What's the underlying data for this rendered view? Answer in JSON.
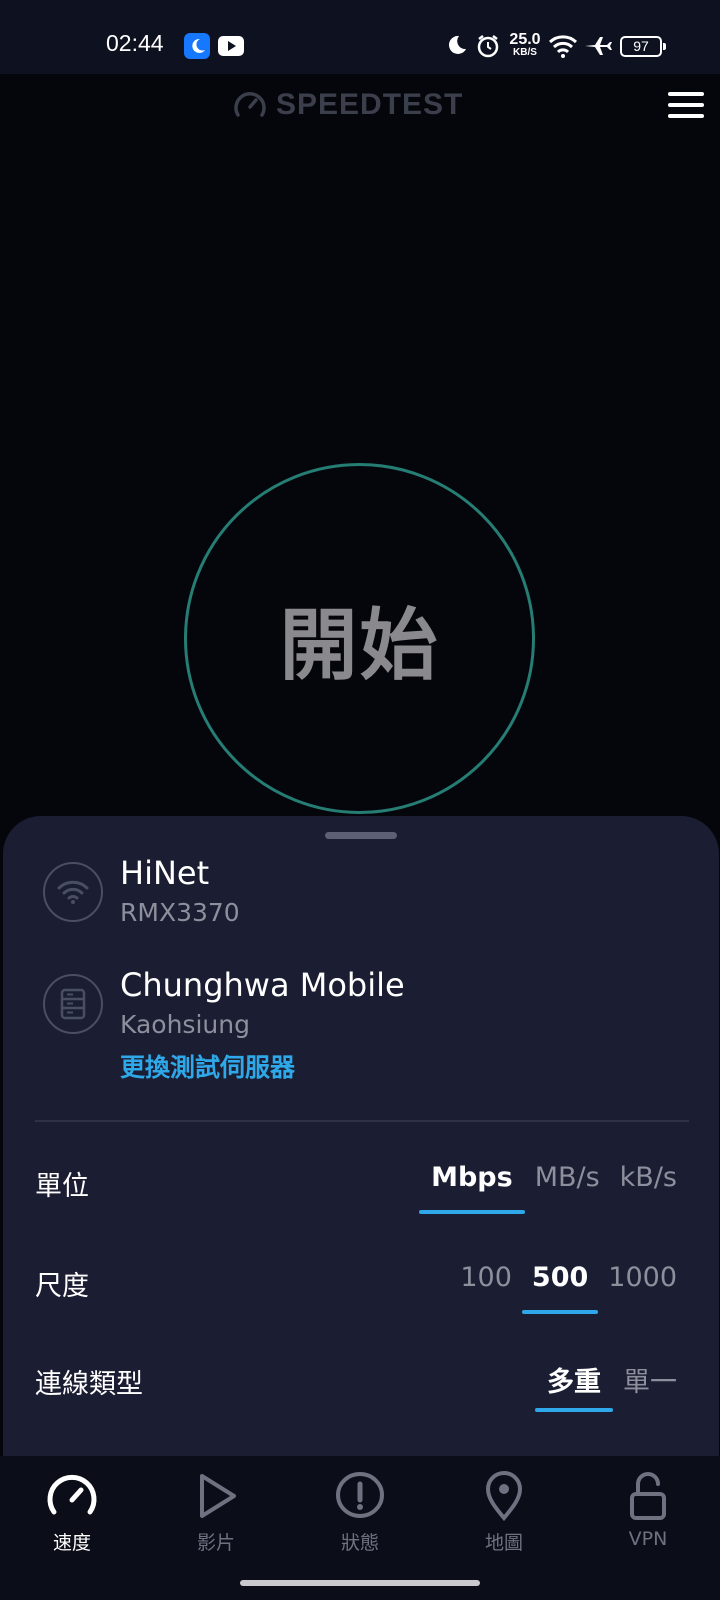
{
  "status_bar": {
    "time": "02:44",
    "net_speed_value": "25.0",
    "net_speed_unit": "KB/S",
    "battery": "97"
  },
  "header": {
    "logo_text": "SPEEDTEST"
  },
  "start": {
    "label": "開始"
  },
  "network": {
    "provider": "HiNet",
    "device": "RMX3370"
  },
  "server": {
    "name": "Chunghwa Mobile",
    "location": "Kaohsiung",
    "change_link": "更換測試伺服器"
  },
  "settings": {
    "unit": {
      "label": "單位",
      "options": [
        "Mbps",
        "MB/s",
        "kB/s"
      ],
      "selected": "Mbps"
    },
    "scale": {
      "label": "尺度",
      "options": [
        "100",
        "500",
        "1000"
      ],
      "selected": "500"
    },
    "connection": {
      "label": "連線類型",
      "options": [
        "多重",
        "單一"
      ],
      "selected": "多重"
    }
  },
  "nav": {
    "items": [
      {
        "label": "速度",
        "icon": "speedometer-icon",
        "active": true
      },
      {
        "label": "影片",
        "icon": "play-icon",
        "active": false
      },
      {
        "label": "狀態",
        "icon": "alert-icon",
        "active": false
      },
      {
        "label": "地圖",
        "icon": "map-pin-icon",
        "active": false
      },
      {
        "label": "VPN",
        "icon": "lock-icon",
        "active": false
      }
    ]
  },
  "colors": {
    "accent": "#2ea8e8",
    "ring": "#257d74",
    "sheet": "#1b1e32",
    "background": "#05060c"
  }
}
